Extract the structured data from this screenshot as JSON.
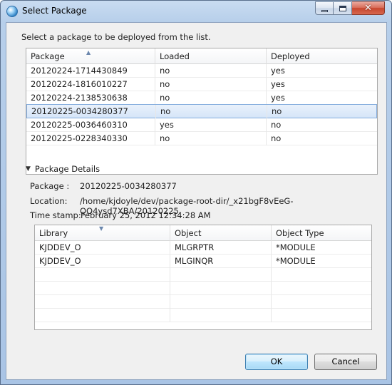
{
  "window": {
    "title": "Select Package",
    "minimize_icon": "minimize-icon",
    "maximize_icon": "maximize-icon",
    "close_icon": "close-icon",
    "close_glyph": "✕"
  },
  "prompt": "Select a package to be deployed from the list.",
  "packages_table": {
    "columns": [
      "Package",
      "Loaded",
      "Deployed"
    ],
    "sorted_column": "Package",
    "rows": [
      [
        "20120224-1714430849",
        "no",
        "yes"
      ],
      [
        "20120224-1816010227",
        "no",
        "yes"
      ],
      [
        "20120224-2138530638",
        "no",
        "yes"
      ],
      [
        "20120225-0034280377",
        "no",
        "no"
      ],
      [
        "20120225-0036460310",
        "yes",
        "no"
      ],
      [
        "20120225-0228340330",
        "no",
        "no"
      ]
    ],
    "selected_row": 3
  },
  "details": {
    "section_title": "Package Details",
    "package_label": "Package :",
    "package_value": "20120225-0034280377",
    "location_label": "Location:",
    "location_value": "/home/kjdoyle/dev/package-root-dir/_x21bgF8vEeG-QO4ysd7XBA/20120225",
    "timestamp_label": "Time stamp:",
    "timestamp_value": "February 25, 2012 12:34:28 AM"
  },
  "objects_table": {
    "columns": [
      "Library",
      "Object",
      "Object Type"
    ],
    "sorted_column": "Library",
    "rows": [
      [
        "KJDDEV_O",
        "MLGRPTR",
        "*MODULE"
      ],
      [
        "KJDDEV_O",
        "MLGINQR",
        "*MODULE"
      ]
    ]
  },
  "buttons": {
    "ok": "OK",
    "cancel": "Cancel"
  },
  "colors": {
    "selection": "#d5e5f8",
    "selection_border": "#84acdd",
    "default_button_border": "#3c7fb1"
  }
}
